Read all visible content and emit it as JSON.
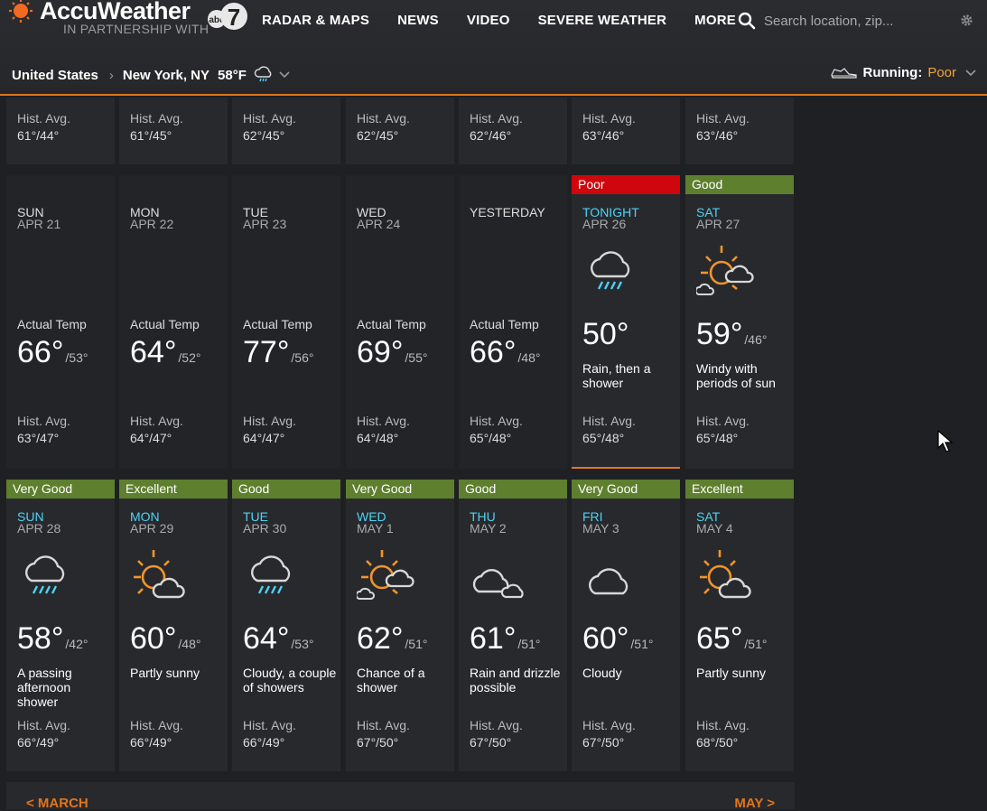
{
  "header": {
    "brand": "AccuWeather",
    "partner": "IN PARTNERSHIP WITH",
    "nav": [
      "RADAR & MAPS",
      "NEWS",
      "VIDEO",
      "SEVERE WEATHER",
      "MORE"
    ],
    "search_placeholder": "Search location, zip...",
    "breadcrumb": {
      "country": "United States",
      "city": "New York, NY",
      "temp": "58°F"
    },
    "running": {
      "label": "Running:",
      "value": "Poor"
    }
  },
  "colors": {
    "accent": "#e0751f",
    "poor": "#d0060e",
    "good": "#5e7f2e",
    "highlight": "#4dd3f5"
  },
  "row0": [
    {
      "hist_label": "Hist. Avg.",
      "hist": "61°/44°"
    },
    {
      "hist_label": "Hist. Avg.",
      "hist": "61°/45°"
    },
    {
      "hist_label": "Hist. Avg.",
      "hist": "62°/45°"
    },
    {
      "hist_label": "Hist. Avg.",
      "hist": "62°/45°"
    },
    {
      "hist_label": "Hist. Avg.",
      "hist": "62°/46°"
    },
    {
      "hist_label": "Hist. Avg.",
      "hist": "63°/46°"
    },
    {
      "hist_label": "Hist. Avg.",
      "hist": "63°/46°"
    }
  ],
  "row1": [
    {
      "day": "SUN",
      "date": "APR 21",
      "actual_label": "Actual Temp",
      "hi": "66°",
      "lo": "/53°",
      "hist_label": "Hist. Avg.",
      "hist": "63°/47°"
    },
    {
      "day": "MON",
      "date": "APR 22",
      "actual_label": "Actual Temp",
      "hi": "64°",
      "lo": "/52°",
      "hist_label": "Hist. Avg.",
      "hist": "64°/47°"
    },
    {
      "day": "TUE",
      "date": "APR 23",
      "actual_label": "Actual Temp",
      "hi": "77°",
      "lo": "/56°",
      "hist_label": "Hist. Avg.",
      "hist": "64°/47°"
    },
    {
      "day": "WED",
      "date": "APR 24",
      "actual_label": "Actual Temp",
      "hi": "69°",
      "lo": "/55°",
      "hist_label": "Hist. Avg.",
      "hist": "64°/48°"
    },
    {
      "day": "YESTERDAY",
      "date": "",
      "actual_label": "Actual Temp",
      "hi": "66°",
      "lo": "/48°",
      "hist_label": "Hist. Avg.",
      "hist": "65°/48°"
    },
    {
      "badge": "Poor",
      "day": "TONIGHT",
      "date": "APR 26",
      "icon": "rain-cloud-icon",
      "hi": "50°",
      "lo": "",
      "desc": "Rain, then a shower",
      "hist_label": "Hist. Avg.",
      "hist": "65°/48°"
    },
    {
      "badge": "Good",
      "day": "SAT",
      "date": "APR 27",
      "icon": "windy-sun-icon",
      "hi": "59°",
      "lo": "/46°",
      "desc": "Windy with periods of sun",
      "hist_label": "Hist. Avg.",
      "hist": "65°/48°"
    }
  ],
  "row2": [
    {
      "badge": "Very Good",
      "day": "SUN",
      "date": "APR 28",
      "icon": "rain-cloud-icon",
      "hi": "58°",
      "lo": "/42°",
      "desc": "A passing afternoon shower",
      "hist_label": "Hist. Avg.",
      "hist": "66°/49°"
    },
    {
      "badge": "Excellent",
      "day": "MON",
      "date": "APR 29",
      "icon": "partly-sunny-icon",
      "hi": "60°",
      "lo": "/48°",
      "desc": "Partly sunny",
      "hist_label": "Hist. Avg.",
      "hist": "66°/49°"
    },
    {
      "badge": "Good",
      "day": "TUE",
      "date": "APR 30",
      "icon": "rain-cloud-icon",
      "hi": "64°",
      "lo": "/53°",
      "desc": "Cloudy, a couple of showers",
      "hist_label": "Hist. Avg.",
      "hist": "66°/49°"
    },
    {
      "badge": "Very Good",
      "day": "WED",
      "date": "MAY 1",
      "icon": "windy-sun-icon",
      "hi": "62°",
      "lo": "/51°",
      "desc": "Chance of a shower",
      "hist_label": "Hist. Avg.",
      "hist": "67°/50°"
    },
    {
      "badge": "Good",
      "day": "THU",
      "date": "MAY 2",
      "icon": "clouds-icon",
      "hi": "61°",
      "lo": "/51°",
      "desc": "Rain and drizzle possible",
      "hist_label": "Hist. Avg.",
      "hist": "67°/50°"
    },
    {
      "badge": "Very Good",
      "day": "FRI",
      "date": "MAY 3",
      "icon": "cloud-icon",
      "hi": "60°",
      "lo": "/51°",
      "desc": "Cloudy",
      "hist_label": "Hist. Avg.",
      "hist": "67°/50°"
    },
    {
      "badge": "Excellent",
      "day": "SAT",
      "date": "MAY 4",
      "icon": "partly-sunny-icon",
      "hi": "65°",
      "lo": "/51°",
      "desc": "Partly sunny",
      "hist_label": "Hist. Avg.",
      "hist": "68°/50°"
    }
  ],
  "month_nav": {
    "prev": "< MARCH",
    "next": "MAY >"
  }
}
